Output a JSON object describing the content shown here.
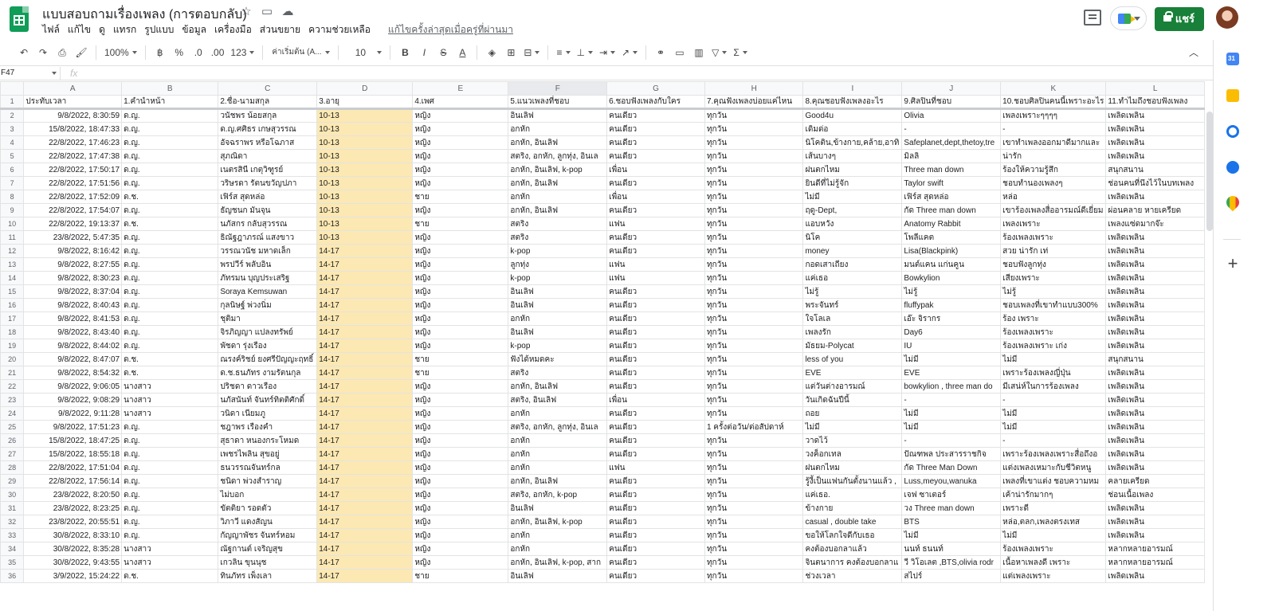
{
  "doc": {
    "title": "แบบสอบถามเรื่องเพลง (การตอบกลับ)",
    "menus": [
      "ไฟล์",
      "แก้ไข",
      "ดู",
      "แทรก",
      "รูปแบบ",
      "ข้อมูล",
      "เครื่องมือ",
      "ส่วนขยาย",
      "ความช่วยเหลือ"
    ],
    "last_edit": "แก้ไขครั้งล่าสุดเมื่อครู่ที่ผ่านมา",
    "share_label": "แชร์"
  },
  "toolbar": {
    "zoom": "100%",
    "currency": "฿",
    "percent": "%",
    "dec_less": ".0",
    "dec_more": ".00",
    "format_more": "123",
    "font": "ค่าเริ่มต้น (A...",
    "font_size": "10",
    "bold": "B",
    "italic": "I",
    "strike": "S",
    "text_color": "A"
  },
  "formula_bar": {
    "cell_ref": "F47",
    "fx": "fx"
  },
  "grid": {
    "columns": [
      "A",
      "B",
      "C",
      "D",
      "E",
      "F",
      "G",
      "H",
      "I",
      "J",
      "K",
      "L"
    ],
    "selected_column": "F",
    "headers": [
      "ประทับเวลา",
      "1.คำนำหน้า",
      "2.ชื่อ-นามสกุล",
      "3.อายุ",
      "4.เพศ",
      "5.แนวเพลงที่ชอบ",
      "6.ชอบฟังเพลงกับใคร",
      "7.คุณฟังเพลงบ่อยแค่ไหน",
      "8.คุณชอบฟังเพลงอะไร",
      "9.ศิลปินที่ชอบ",
      "10.ชอบศิลปินคนนี้เพราะอะไร",
      "11.ทำไมถึงชอบฟังเพลง"
    ],
    "rows": [
      [
        "9/8/2022, 8:30:59",
        "ด.ญ.",
        "วนัชพร น้อยสกุล",
        "10-13",
        "หญิง",
        "อินเลิฟ",
        "คนเดียว",
        "ทุกวัน",
        "Good4u",
        "Olivia",
        "เพลงเพราะๆๆๆๆ",
        "เพลิดเพลิน"
      ],
      [
        "15/8/2022, 18:47:33",
        "ด.ญ.",
        "ด.ญ.ศศิธร เกษสุวรรณ",
        "10-13",
        "หญิง",
        "อกหัก",
        "คนเดียว",
        "ทุกวัน",
        "เดิมด่อ",
        "-",
        "-",
        "เพลิดเพลิน"
      ],
      [
        "22/8/2022, 17:46:23",
        "ด.ญ.",
        "อัจฉราพร หรือโฉภาส",
        "10-13",
        "หญิง",
        "อกหัก, อินเลิฟ",
        "คนเดียว",
        "ทุกวัน",
        "นิโคติน,ข้างกาย,คล้าย,อาทิ",
        "Safeplanet,dept,thetoy,tre",
        "เขาทำเพลงออกมาดีมากและ",
        "เพลิดเพลิน"
      ],
      [
        "22/8/2022, 17:47:38",
        "ด.ญ.",
        "สุภณิดา",
        "10-13",
        "หญิง",
        "สตริง, อกหัก, ลูกทุ่ง, อินเล",
        "คนเดียว",
        "ทุกวัน",
        "เส้นบางๆ",
        "มิลลิ",
        "น่ารัก",
        "เพลิดเพลิน"
      ],
      [
        "22/8/2022, 17:50:17",
        "ด.ญ.",
        "เนตรสินี เกตุวิฑูรย์",
        "10-13",
        "หญิง",
        "อกหัก, อินเลิฟ, k-pop",
        "เพื่อน",
        "ทุกวัน",
        "ฝนตกไหม",
        "Three man down",
        "ร้องให้ความรู้สึก",
        "สนุกสนาน"
      ],
      [
        "22/8/2022, 17:51:56",
        "ด.ญ.",
        "วริษรดา รัตนขวัญปภา",
        "10-13",
        "หญิง",
        "อกหัก, อินเลิฟ",
        "คนเดียว",
        "ทุกวัน",
        "ยินดีที่ไม่รู้จัก",
        "Taylor swift",
        "ชอบทำนองเพลงๆ",
        "ช่อนคนที่นึงไว้ในบทเพลง"
      ],
      [
        "22/8/2022, 17:52:09",
        "ด.ช.",
        "เฟิร์ส สุดหล่อ",
        "10-13",
        "ชาย",
        "อกหัก",
        "เพื่อน",
        "ทุกวัน",
        "ไม่มี",
        "เฟิร์ส สุดหล่อ",
        "หล่อ",
        "เพลิดเพลิน"
      ],
      [
        "22/8/2022, 17:54:07",
        "ด.ญ.",
        "ธัญชนก มันจุน",
        "10-13",
        "หญิง",
        "อกหัก, อินเลิฟ",
        "คนเดียว",
        "ทุกวัน",
        "ฤดู-Dept,",
        "กัด Three man down",
        "เขาร้องเพลงสื่ออารมณ์ดีเยี่ยม",
        "ผ่อนคลาย หายเครียด"
      ],
      [
        "22/8/2022, 19:13:37",
        "ด.ช.",
        "นภัสกร กลับสุวรรณ",
        "10-13",
        "ชาย",
        "สตริง",
        "แฟน",
        "ทุกวัน",
        "แอบหวัง",
        "Anatomy Rabbit",
        "เพลงเพราะ",
        "เพลงแซ่ดมากจ๊ะ"
      ],
      [
        "23/8/2022, 5:47:35",
        "ด.ญ.",
        "ธิณัฐฎาภรณ์ แสงขาว",
        "10-13",
        "หญิง",
        "สตริง",
        "คนเดียว",
        "ทุกวัน",
        "นิโค",
        "โพลีแคต",
        "ร้องเพลงเพราะ",
        "เพลิดเพลิน"
      ],
      [
        "9/8/2022, 8:16:42",
        "ด.ญ.",
        " วรรณวนัช มหาดเล็ก",
        "14-17",
        "หญิง",
        "k-pop",
        "คนเดียว",
        "ทุกวัน",
        "money",
        "Lisa(Blackpink)",
        "สวย น่ารัก เท่",
        "เพลิดเพลิน"
      ],
      [
        "9/8/2022, 8:27:55",
        "ด.ญ.",
        "พรปวีร์ พลับอิน",
        "14-17",
        "หญิง",
        "ลูกทุ่ง",
        "แฟน",
        "ทุกวัน",
        "กอดเสาเถียง",
        "มนต์แคน แก่นคูน",
        "ชอบฟังลูกทุ่ง",
        "เพลิดเพลิน"
      ],
      [
        "9/8/2022, 8:30:23",
        "ด.ญ.",
        "ภัทรมน บุญประเสริฐ",
        "14-17",
        "หญิง",
        "k-pop",
        "แฟน",
        "ทุกวัน",
        "แค่เธอ",
        "Bowkylion",
        "เสียงเพราะ",
        "เพลิดเพลิน"
      ],
      [
        "9/8/2022, 8:37:04",
        "ด.ญ.",
        "Soraya Kemsuwan",
        "14-17",
        "หญิง",
        "อินเลิฟ",
        "คนเดียว",
        "ทุกวัน",
        "ไม่รู้",
        "ไม่รู้",
        "ไม่รู้",
        "เพลิดเพลิน"
      ],
      [
        "9/8/2022, 8:40:43",
        "ด.ญ.",
        "กุลนิษฐ์ พ่วงนิ่ม",
        "14-17",
        "หญิง",
        "อินเลิฟ",
        "คนเดียว",
        "ทุกวัน",
        "พระจันทร์",
        "fluffypak",
        "ชอบเพลงที่เขาทำแบบ300%",
        "เพลิดเพลิน"
      ],
      [
        "9/8/2022, 8:41:53",
        "ด.ญ.",
        "ชุติมา",
        "14-17",
        "หญิง",
        "อกหัก",
        "คนเดียว",
        "ทุกวัน",
        "ใจโลเล",
        "เอ๊ะ จิรากร",
        "ร้อง เพราะ",
        "เพลิดเพลิน"
      ],
      [
        "9/8/2022, 8:43:40",
        "ด.ญ.",
        "จิรภิญญา แปลงทรัพย์",
        "14-17",
        "หญิง",
        "อินเลิฟ",
        "คนเดียว",
        "ทุกวัน",
        "เพลงรัก",
        "Day6",
        "ร้องเพลงเพราะ",
        "เพลิดเพลิน"
      ],
      [
        "9/8/2022, 8:44:02",
        "ด.ญ.",
        "พัชดา รุ่งเรือง",
        "14-17",
        "หญิง",
        "k-pop",
        "คนเดียว",
        "ทุกวัน",
        "มัธยม-Polycat",
        "IU",
        "ร้องเพลงเพราะ เก่ง",
        "เพลิดเพลิน"
      ],
      [
        "9/8/2022, 8:47:07",
        "ด.ช.",
        "ณรงค์ริชย์ ยงศรีปัญญะฤทธิ์",
        "14-17",
        "ชาย",
        "ฟังได้หมดคะ",
        "คนเดียว",
        "ทุกวัน",
        "less of you",
        "ไม่มี",
        "ไม่มี",
        "สนุกสนาน"
      ],
      [
        "9/8/2022, 8:54:32",
        "ด.ช.",
        "ด.ช.ธนภัทร งามรัตนกุล",
        "14-17",
        "ชาย",
        "สตริง",
        "คนเดียว",
        "ทุกวัน",
        "EVE",
        "EVE",
        "เพราะร้องเพลงญี่ปุ่น",
        "เพลิดเพลิน"
      ],
      [
        "9/8/2022, 9:06:05",
        "นางสาว",
        "ปริชดา ดาวเรือง",
        "14-17",
        "หญิง",
        "อกหัก, อินเลิฟ",
        "คนเดียว",
        "ทุกวัน",
        "แต่วันต่างอารมณ์",
        "bowkylion , three man do",
        "มีเสน่ห์ในการร้องเพลง",
        "เพลิดเพลิน"
      ],
      [
        "9/8/2022, 9:08:29",
        "นางสาว",
        "นภัสนันท์ จันทร์ทิตติศักดิ์",
        "14-17",
        "หญิง",
        "สตริง, อินเลิฟ",
        "เพื่อน",
        "ทุกวัน",
        "วันเกิดฉันปีนี้",
        "-",
        "-",
        "เพลิดเพลิน"
      ],
      [
        "9/8/2022, 9:11:28",
        "นางสาว",
        "วนิดา เนียมภู",
        "14-17",
        "หญิง",
        "อกหัก",
        "คนเดียว",
        "ทุกวัน",
        "ถอย",
        "ไม่มี",
        "ไม่มี",
        "เพลิดเพลิน"
      ],
      [
        "9/8/2022, 17:51:23",
        "ด.ญ.",
        "ชฎาพร เรืองคำ",
        "14-17",
        "หญิง",
        "สตริง, อกหัก, ลูกทุ่ง, อินเล",
        "คนเดียว",
        "1 ครั้งต่อวัน/ต่อสัปดาห์",
        "ไม่มี",
        "ไม่มี",
        "ไม่มี",
        "เพลิดเพลิน"
      ],
      [
        "15/8/2022, 18:47:25",
        "ด.ญ.",
        "สุธาดา หนองกระโหมด",
        "14-17",
        "หญิง",
        "อกหัก",
        "คนเดียว",
        "ทุกวัน",
        "วาดไว้",
        "-",
        "-",
        "เพลิดเพลิน"
      ],
      [
        "15/8/2022, 18:55:18",
        "ด.ญ.",
        "เพชรไพลิน สุขอยู่",
        "14-17",
        "หญิง",
        "อกหัก",
        "คนเดียว",
        "ทุกวัน",
        "วงค็อกเทล",
        "ปัณฑพล ประสารราชกิจ",
        "เพราะร้องเพลงเพราะสื่อถึงอ",
        "เพลิดเพลิน"
      ],
      [
        "22/8/2022, 17:51:04",
        "ด.ญ.",
        "ธนวรรณจันทร์กล",
        "14-17",
        "หญิง",
        "อกหัก",
        "แฟน",
        "ทุกวัน",
        "ฝนตกไหม",
        " กัด Three Man Down",
        "แต่งเพลงเหมาะกับชีวิตหนู",
        "เพลิดเพลิน"
      ],
      [
        "22/8/2022, 17:56:14",
        "ด.ญ.",
        "ชนิดา พ่วงสำราญ",
        "14-17",
        "หญิง",
        "อกหัก, อินเลิฟ",
        "คนเดียว",
        "ทุกวัน",
        "รู้งี้เป็นแฟนกันตั้งนานแล้ว ,",
        " Luss,meyou,wanuka",
        "เพลงที่เขาแต่ง ชอบความหม",
        "คลายเครียด"
      ],
      [
        "23/8/2022, 8:20:50",
        "ด.ญ.",
        "ไม่บอก",
        "14-17",
        "หญิง",
        "สตริง, อกหัก, k-pop",
        "คนเดียว",
        "ทุกวัน",
        "แค่เธอ.",
        "เจฟ ซาเตอร์",
        "เค้าน่ารักมากๆ",
        "ช่อนเนื้อเพลง"
      ],
      [
        "23/8/2022, 8:23:25",
        "ด.ญ.",
        "ขัตติยา รอดตัว",
        "14-17",
        "หญิง",
        "อินเลิฟ",
        "คนเดียว",
        "ทุกวัน",
        "ข้างกาย",
        "วง Three man down",
        "เพราะดี",
        "เพลิดเพลิน"
      ],
      [
        "23/8/2022, 20:55:51",
        "ด.ญ.",
        "วิภาวี แดงสัญน",
        "14-17",
        "หญิง",
        "อกหัก, อินเลิฟ, k-pop",
        "คนเดียว",
        "ทุกวัน",
        "casual , double take",
        "BTS",
        "หล่อ,ตลก,เพลงตรงเทส",
        "เพลิดเพลิน"
      ],
      [
        "30/8/2022, 8:33:10",
        "ด.ญ.",
        "กัญญาพัชร จันทร์หอม",
        "14-17",
        "หญิง",
        "อกหัก",
        "คนเดียว",
        "ทุกวัน",
        "ขอให้โลกใจดีกับเธอ",
        "ไม่มี",
        "ไม่มี",
        "เพลิดเพลิน"
      ],
      [
        "30/8/2022, 8:35:28",
        "นางสาว",
        "ณัฐกานต์ เจริญสุข",
        "14-17",
        "หญิง",
        "อกหัก",
        "คนเดียว",
        "ทุกวัน",
        "คงต้องบอกลาแล้ว",
        "นนท์ ธนนท์",
        "ร้องเพลงเพราะ",
        "หลากหลายอารมณ์"
      ],
      [
        "30/8/2022, 9:43:55",
        "นางสาว",
        "เกวลิน ขุนนุช",
        "14-17",
        "หญิง",
        "อกหัก, อินเลิฟ, k-pop, สาก",
        "คนเดียว",
        "ทุกวัน",
        "จินตนาการ คงต้องบอกลาแ",
        "วี วิโอเลต ,BTS,olivia rodr",
        "เนื้อหาเพลงดี เพราะ",
        "หลากหลายอารมณ์"
      ],
      [
        "3/9/2022, 15:24:22",
        "ด.ช.",
        "ทินภัทร เพ็งเลา",
        "14-17",
        "ชาย",
        "อินเลิฟ",
        "คนเดียว",
        "ทุกวัน",
        "ช่วงเวลา",
        "สไปร์",
        "แต่เพลงเพราะ",
        "เพลิดเพลิน"
      ]
    ]
  }
}
